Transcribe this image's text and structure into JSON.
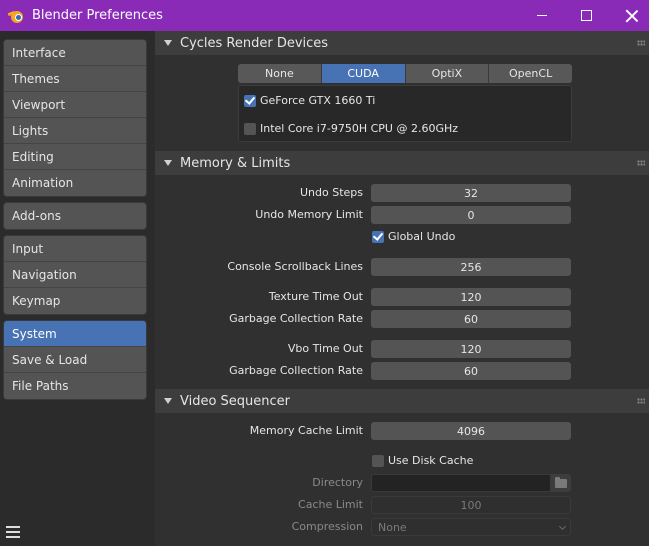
{
  "window": {
    "title": "Blender Preferences"
  },
  "sidebar": {
    "groups": [
      [
        "Interface",
        "Themes",
        "Viewport",
        "Lights",
        "Editing",
        "Animation"
      ],
      [
        "Add-ons"
      ],
      [
        "Input",
        "Navigation",
        "Keymap"
      ],
      [
        "System",
        "Save & Load",
        "File Paths"
      ]
    ],
    "active": "System"
  },
  "cycles": {
    "title": "Cycles Render Devices",
    "tabs": [
      "None",
      "CUDA",
      "OptiX",
      "OpenCL"
    ],
    "active_tab": "CUDA",
    "devices": [
      {
        "label": "GeForce GTX 1660 Ti",
        "checked": true
      },
      {
        "label": "Intel Core i7-9750H CPU @ 2.60GHz",
        "checked": false
      }
    ]
  },
  "memory": {
    "title": "Memory & Limits",
    "undo_steps_label": "Undo Steps",
    "undo_steps": "32",
    "undo_memory_label": "Undo Memory Limit",
    "undo_memory": "0",
    "global_undo_label": "Global Undo",
    "global_undo": true,
    "console_label": "Console Scrollback Lines",
    "console": "256",
    "texture_timeout_label": "Texture Time Out",
    "texture_timeout": "120",
    "gc_rate_label": "Garbage Collection Rate",
    "gc_rate": "60",
    "vbo_timeout_label": "Vbo Time Out",
    "vbo_timeout": "120",
    "vbo_gc_rate_label": "Garbage Collection Rate",
    "vbo_gc_rate": "60"
  },
  "video": {
    "title": "Video Sequencer",
    "cache_limit_label": "Memory Cache Limit",
    "cache_limit": "4096",
    "disk_cache_label": "Use Disk Cache",
    "disk_cache": false,
    "directory_label": "Directory",
    "directory": "",
    "disk_cache_limit_label": "Cache Limit",
    "disk_cache_limit": "100",
    "compression_label": "Compression",
    "compression": "None"
  }
}
